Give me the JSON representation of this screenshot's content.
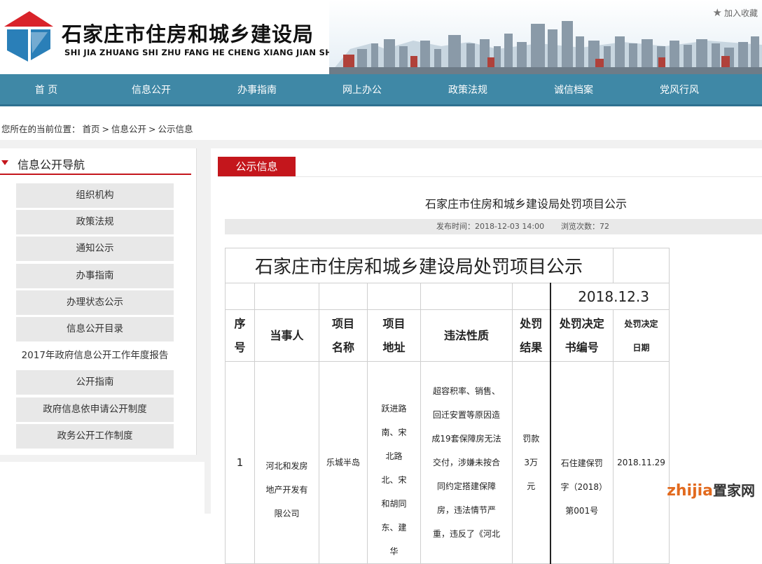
{
  "header": {
    "title": "石家庄市住房和城乡建设局",
    "pinyin": "SHI JIA ZHUANG SHI ZHU FANG HE CHENG XIANG JIAN SHE JU",
    "favorite": "加入收藏"
  },
  "nav": [
    "首 页",
    "信息公开",
    "办事指南",
    "网上办公",
    "政策法规",
    "诚信档案",
    "党风行风"
  ],
  "breadcrumb": {
    "prefix": "您所在的当前位置：",
    "items": [
      "首页",
      "信息公开",
      "公示信息"
    ],
    "sep": ">"
  },
  "sidebar": {
    "heading": "信息公开导航",
    "items": [
      "组织机构",
      "政策法规",
      "通知公示",
      "办事指南",
      "办理状态公示",
      "信息公开目录",
      "2017年政府信息公开工作年度报告",
      "公开指南",
      "政府信息依申请公开制度",
      "政务公开工作制度"
    ]
  },
  "main": {
    "tab": "公示信息",
    "article_title": "石家庄市住房和城乡建设局处罚项目公示",
    "publish_label": "发布时间：2018-12-03 14:00",
    "views_label": "浏览次数：72",
    "table": {
      "title": "石家庄市住房和城乡建设局处罚项目公示",
      "date": "2018.12.3",
      "headers": [
        "序号",
        "当事人",
        "项目名称",
        "项目地址",
        "违法性质",
        "处罚结果",
        "处罚决定书编号",
        "处罚决定日期"
      ],
      "row": {
        "no": "1",
        "party": "河北和发房地产开发有限公司",
        "project": "乐城半岛",
        "address": "跃进路南、宋北路北、宋和胡同东、建华",
        "nature": "超容积率、销售、回迁安置等原因造成19套保障房无法交付，涉嫌未按合同约定搭建保障房，违法情节严重，违反了《河北",
        "result": "罚款3万元",
        "doc_no": "石住建保罚字（2018）第001号",
        "date": "2018.11.29"
      }
    }
  },
  "watermark": {
    "brand": "zhijia",
    "cn": "置家网"
  }
}
